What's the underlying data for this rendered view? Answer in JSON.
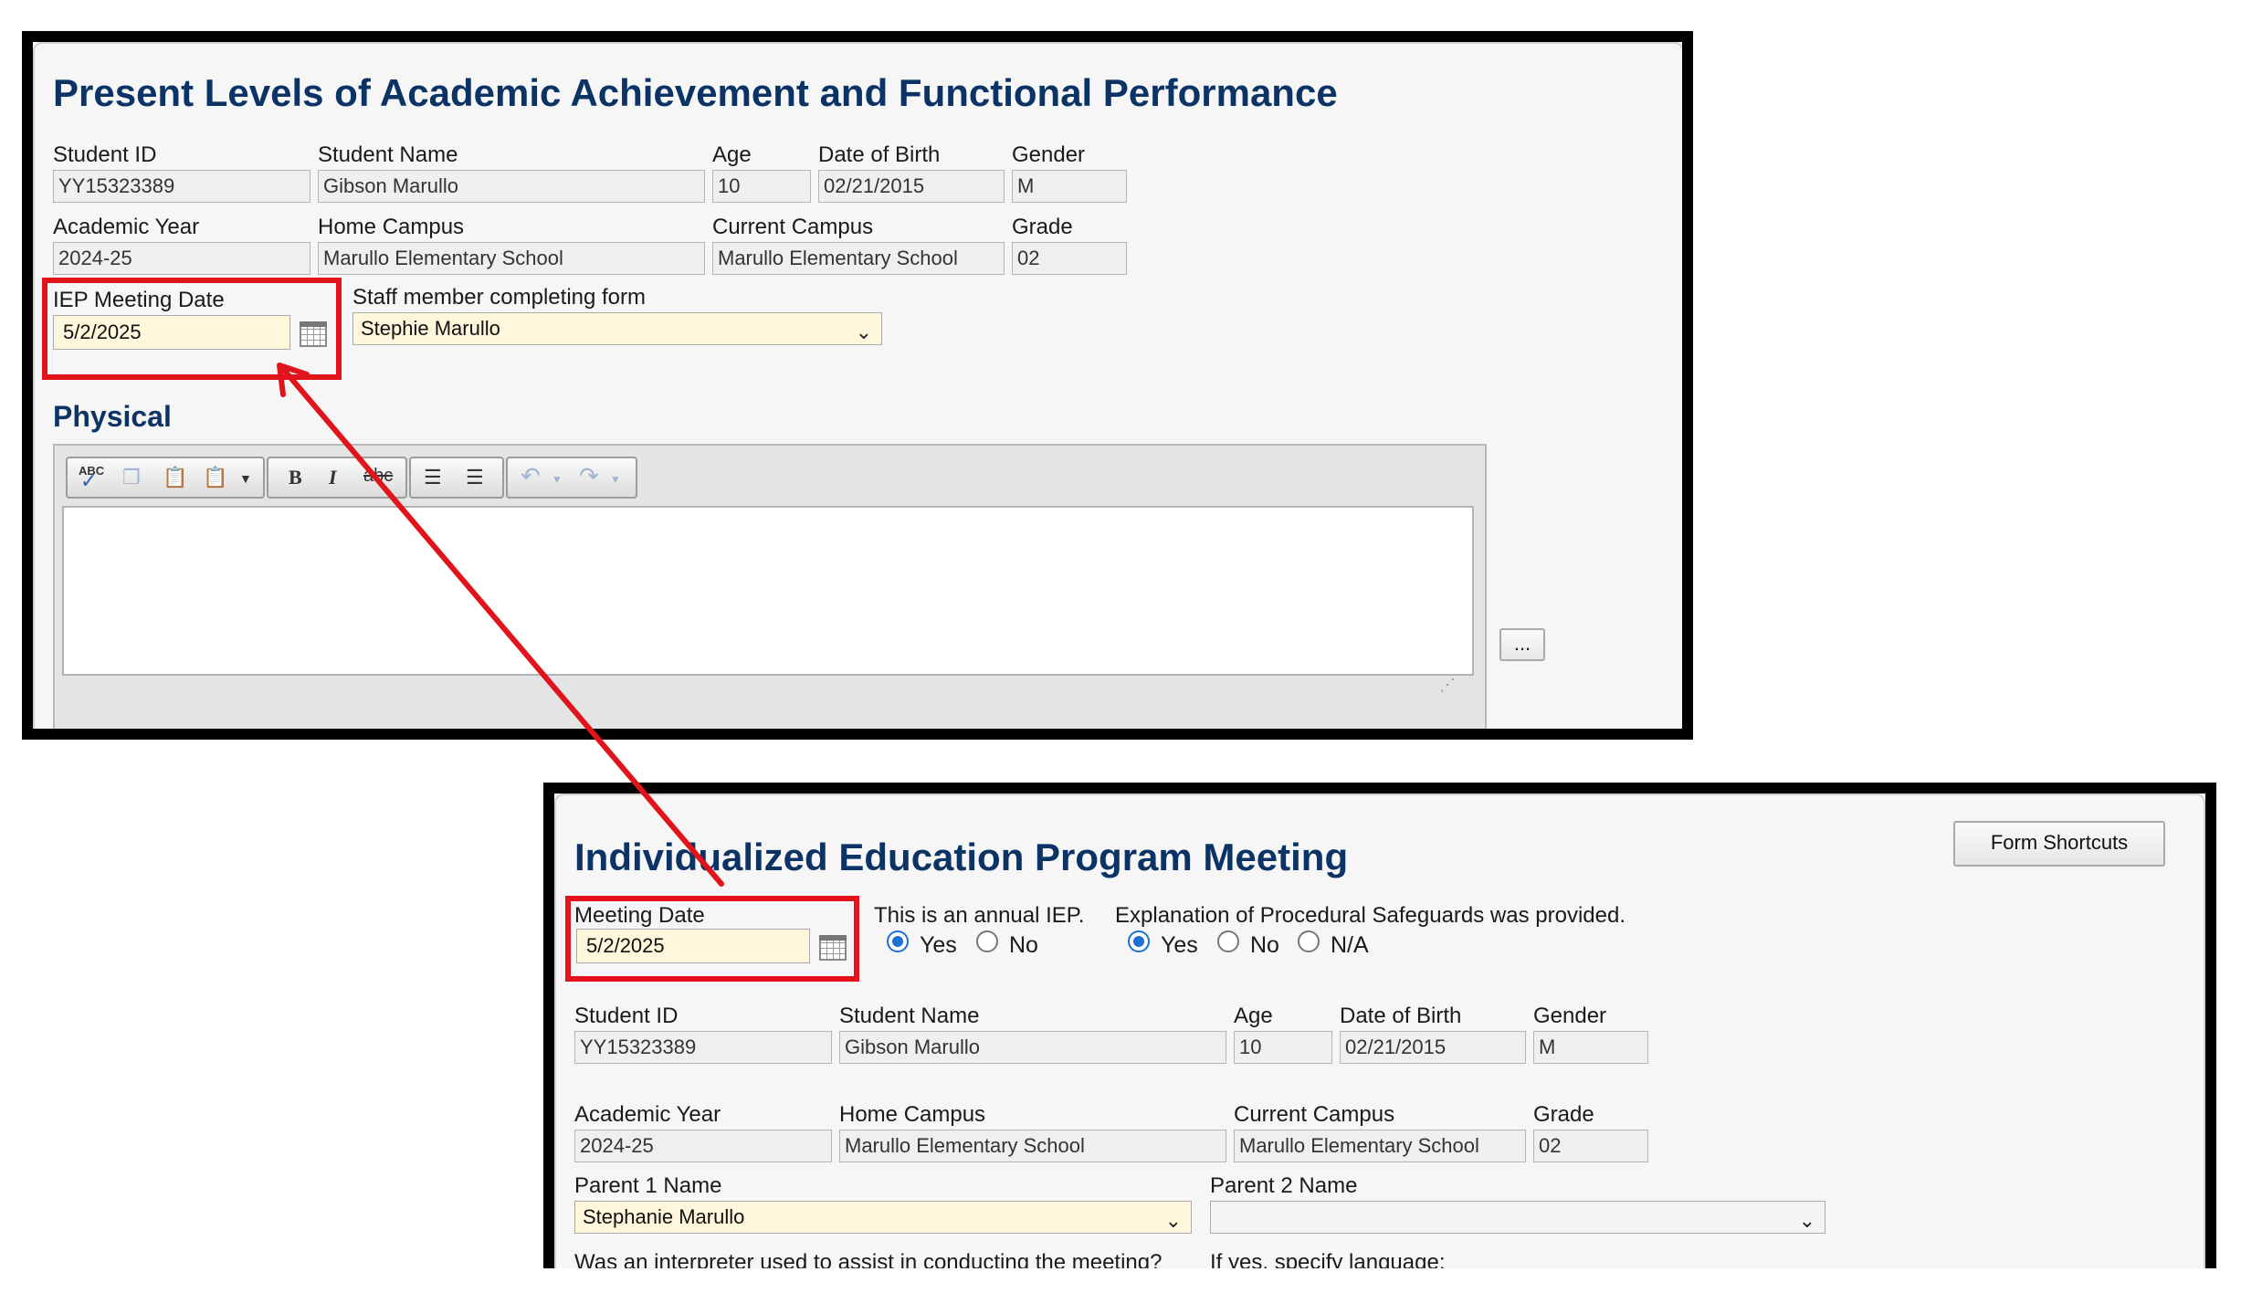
{
  "panel1": {
    "title": "Present Levels of Academic Achievement and Functional Performance",
    "labels": {
      "student_id": "Student ID",
      "student_name": "Student Name",
      "age": "Age",
      "dob": "Date of Birth",
      "gender": "Gender",
      "academic_year": "Academic Year",
      "home_campus": "Home Campus",
      "current_campus": "Current Campus",
      "grade": "Grade",
      "iep_meeting_date": "IEP Meeting Date",
      "staff": "Staff member completing form"
    },
    "values": {
      "student_id": "YY15323389",
      "student_name": "Gibson Marullo",
      "age": "10",
      "dob": "02/21/2015",
      "gender": "M",
      "academic_year": "2024-25",
      "home_campus": "Marullo Elementary School",
      "current_campus": "Marullo Elementary School",
      "grade": "02",
      "iep_meeting_date": "5/2/2025",
      "staff": "Stephie Marullo"
    },
    "section_physical": "Physical",
    "toolbar": {
      "bold": "B",
      "italic": "I",
      "strike": "abc",
      "spell": "ABC",
      "ul": "☰",
      "ol": "☰",
      "undo": "↶",
      "redo": "↷"
    },
    "more_button": "..."
  },
  "panel2": {
    "title": "Individualized Education Program Meeting",
    "form_shortcuts": "Form Shortcuts",
    "labels": {
      "meeting_date": "Meeting Date",
      "annual_iep": "This is an annual IEP.",
      "safeguards": "Explanation of Procedural Safeguards was provided.",
      "student_id": "Student ID",
      "student_name": "Student Name",
      "age": "Age",
      "dob": "Date of Birth",
      "gender": "Gender",
      "academic_year": "Academic Year",
      "home_campus": "Home Campus",
      "current_campus": "Current Campus",
      "grade": "Grade",
      "parent1": "Parent 1 Name",
      "parent2": "Parent 2 Name",
      "interpreter": "Was an interpreter used to assist in conducting the meeting?",
      "language": "If yes, specify language:"
    },
    "values": {
      "meeting_date": "5/2/2025",
      "student_id": "YY15323389",
      "student_name": "Gibson Marullo",
      "age": "10",
      "dob": "02/21/2015",
      "gender": "M",
      "academic_year": "2024-25",
      "home_campus": "Marullo Elementary School",
      "current_campus": "Marullo Elementary School",
      "grade": "02",
      "parent1": "Stephanie Marullo",
      "parent2": ""
    },
    "annual_iep_options": {
      "yes": "Yes",
      "no": "No",
      "selected": "yes"
    },
    "safeguards_options": {
      "yes": "Yes",
      "no": "No",
      "na": "N/A",
      "selected": "yes"
    }
  },
  "colors": {
    "title": "#0b3366",
    "highlight": "#e0141a",
    "editable_field": "#fff6db",
    "radio_selected": "#1f6fd6"
  }
}
